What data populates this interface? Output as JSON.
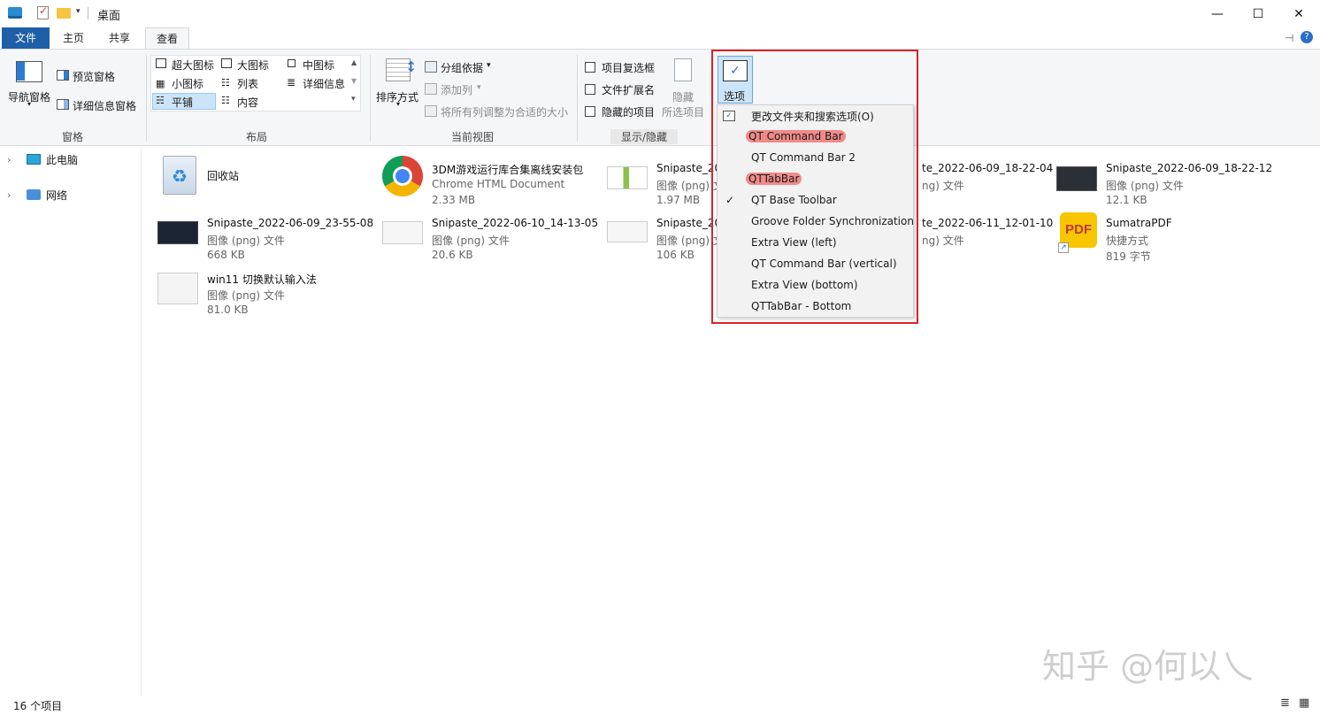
{
  "window": {
    "title": "桌面",
    "controls": {
      "minimize": "—",
      "maximize": "☐",
      "close": "✕"
    }
  },
  "tabs": [
    {
      "label": "文件"
    },
    {
      "label": "主页"
    },
    {
      "label": "共享"
    },
    {
      "label": "查看"
    }
  ],
  "ribbon": {
    "panes": {
      "nav_pane": "导航窗格",
      "preview_pane": "预览窗格",
      "details_pane": "详细信息窗格",
      "group_label": "窗格"
    },
    "layout": {
      "items": [
        "超大图标",
        "大图标",
        "中图标",
        "小图标",
        "列表",
        "详细信息",
        "平铺",
        "内容"
      ],
      "selected": "平铺",
      "group_label": "布局"
    },
    "current_view": {
      "sort_by": "排序方式",
      "group_by": "分组依据",
      "add_columns": "添加列",
      "fit_columns": "将所有列调整为合适的大小",
      "group_label": "当前视图"
    },
    "show_hide": {
      "item_checkboxes": "项目复选框",
      "file_extensions": "文件扩展名",
      "hidden_items": "隐藏的项目",
      "hide_selected_line1": "隐藏",
      "hide_selected_line2": "所选项目",
      "group_label": "显示/隐藏"
    },
    "options_label": "选项"
  },
  "dropdown": {
    "items": [
      {
        "label": "更改文件夹和搜索选项(O)",
        "checked": false,
        "highlight": false,
        "has_icon": true
      },
      {
        "label": "QT Command Bar",
        "checked": false,
        "highlight": true
      },
      {
        "label": "QT Command Bar 2",
        "checked": false,
        "highlight": false
      },
      {
        "label": "QTTabBar",
        "checked": false,
        "highlight": true
      },
      {
        "label": "QT Base Toolbar",
        "checked": true,
        "highlight": false
      },
      {
        "label": "Groove Folder Synchronization",
        "checked": false,
        "highlight": false
      },
      {
        "label": "Extra View (left)",
        "checked": false,
        "highlight": false
      },
      {
        "label": "QT Command Bar (vertical)",
        "checked": false,
        "highlight": false
      },
      {
        "label": "Extra View (bottom)",
        "checked": false,
        "highlight": false
      },
      {
        "label": "QTTabBar - Bottom",
        "checked": false,
        "highlight": false
      }
    ]
  },
  "nav": {
    "items": [
      {
        "label": "此电脑"
      },
      {
        "label": "网络"
      }
    ]
  },
  "files": [
    {
      "name": "回收站",
      "type": "",
      "size": "",
      "icon": "recycle-bin-icon"
    },
    {
      "name": "3DM游戏运行库合集离线安装包",
      "type": "Chrome HTML Document",
      "size": "2.33 MB",
      "icon": "chrome-icon"
    },
    {
      "name": "Snipaste_202",
      "type": "图像 (png) 文",
      "size": "1.97 MB",
      "icon": "image-thumb-icon"
    },
    {
      "name": "te_2022-06-09_18-22-04",
      "type": "ng) 文件",
      "size": "",
      "icon": ""
    },
    {
      "name": "Snipaste_2022-06-09_18-22-12",
      "type": "图像 (png) 文件",
      "size": "12.1 KB",
      "icon": "image-thumb-icon"
    },
    {
      "name": "Snipaste_2022-06-09_23-55-08",
      "type": "图像 (png) 文件",
      "size": "668 KB",
      "icon": "image-thumb-icon"
    },
    {
      "name": "Snipaste_2022-06-10_14-13-05",
      "type": "图像 (png) 文件",
      "size": "20.6 KB",
      "icon": "image-thumb-icon"
    },
    {
      "name": "Snipaste_202",
      "type": "图像 (png) 文",
      "size": "106 KB",
      "icon": "image-thumb-icon"
    },
    {
      "name": "te_2022-06-11_12-01-10",
      "type": "ng) 文件",
      "size": "",
      "icon": ""
    },
    {
      "name": "SumatraPDF",
      "type": "快捷方式",
      "size": "819 字节",
      "icon": "pdf-shortcut-icon"
    },
    {
      "name": "win11 切换默认输入法",
      "type": "图像 (png) 文件",
      "size": "81.0 KB",
      "icon": "image-thumb-icon"
    }
  ],
  "status": {
    "count": "16 个项目"
  },
  "watermark": "知乎 @何以乀"
}
